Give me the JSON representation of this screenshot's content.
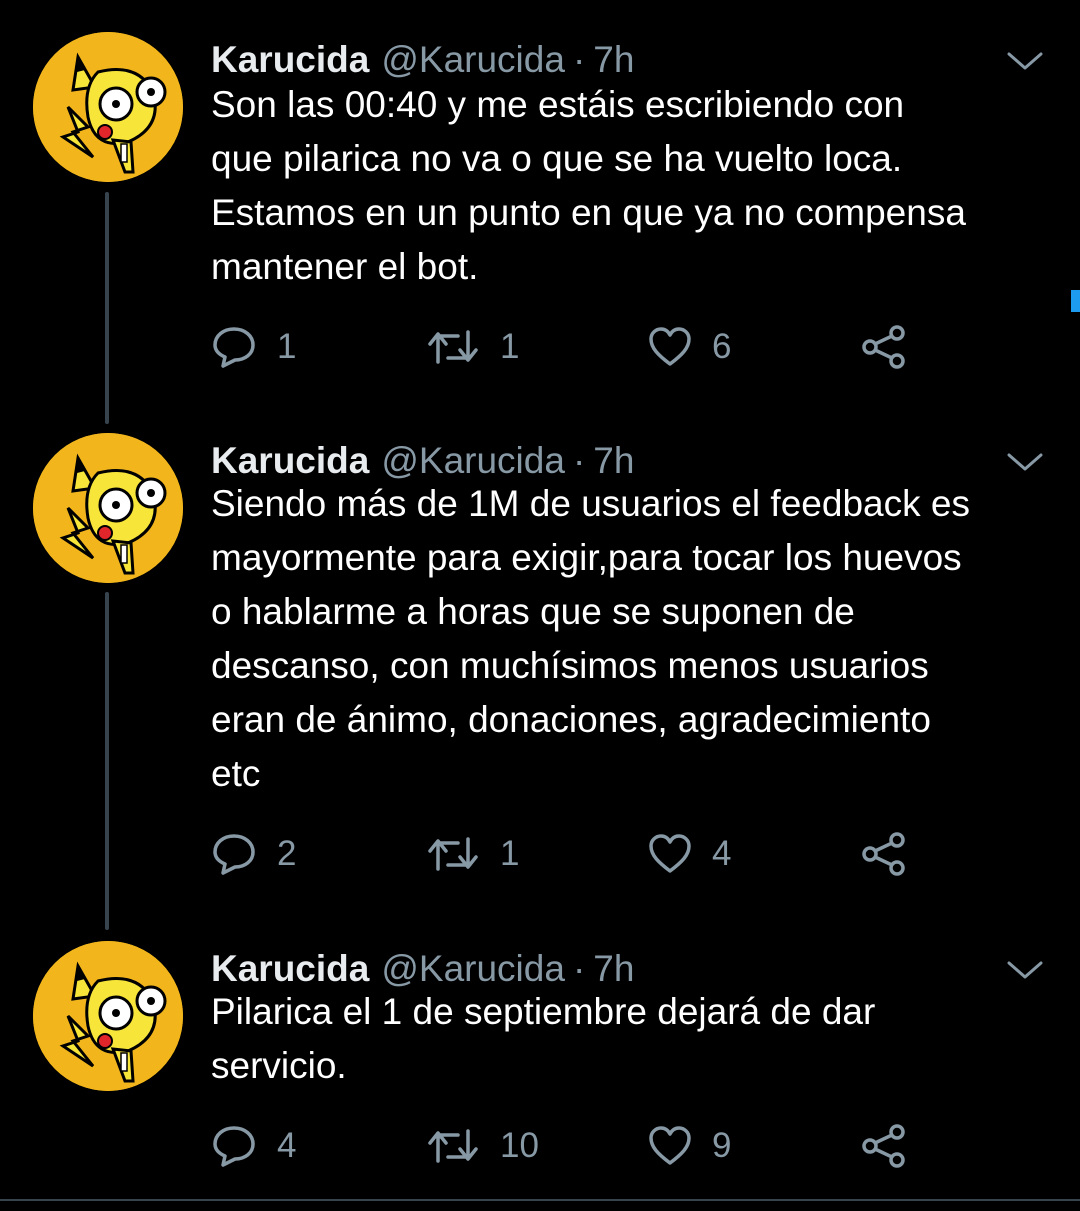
{
  "colors": {
    "background": "#000000",
    "text_primary": "#ffffff",
    "text_secondary": "#8899a6",
    "thread_line": "#38444d",
    "accent": "#1d9bf0",
    "avatar_bg": "#f2b61c"
  },
  "tweets": [
    {
      "author_name": "Karucida",
      "author_handle": "@Karucida",
      "separator": "·",
      "time": "7h",
      "text": "Son las 00:40 y me estáis escribiendo con\nque pilarica no va o que se ha vuelto loca.\nEstamos en un punto en que ya no compensa\nmantener el bot.",
      "replies": "1",
      "retweets": "1",
      "likes": "6",
      "icons": [
        "reply-icon",
        "retweet-icon",
        "like-icon",
        "share-icon",
        "chevron-down-icon"
      ]
    },
    {
      "author_name": "Karucida",
      "author_handle": "@Karucida",
      "separator": "·",
      "time": "7h",
      "text": "Siendo más de 1M de usuarios el feedback es\nmayormente para exigir,para tocar los huevos\no hablarme a horas que se suponen de\ndescanso, con muchísimos menos usuarios\neran de ánimo, donaciones, agradecimiento\netc",
      "replies": "2",
      "retweets": "1",
      "likes": "4",
      "icons": [
        "reply-icon",
        "retweet-icon",
        "like-icon",
        "share-icon",
        "chevron-down-icon"
      ]
    },
    {
      "author_name": "Karucida",
      "author_handle": "@Karucida",
      "separator": "·",
      "time": "7h",
      "text": "Pilarica el 1 de septiembre dejará de dar\nservicio.",
      "replies": "4",
      "retweets": "10",
      "likes": "9",
      "icons": [
        "reply-icon",
        "retweet-icon",
        "like-icon",
        "share-icon",
        "chevron-down-icon"
      ]
    }
  ]
}
